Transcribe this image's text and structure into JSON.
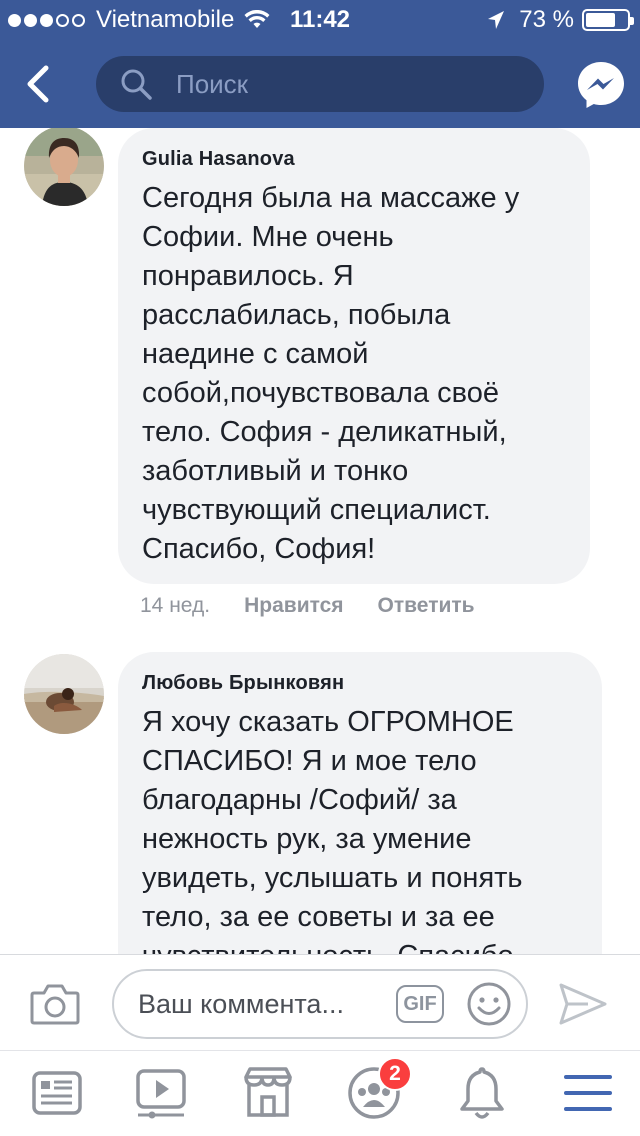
{
  "status_bar": {
    "carrier": "Vietnamobile",
    "time": "11:42",
    "battery_percent": "73 %",
    "battery_level": 0.73,
    "signal_bars_filled": 3,
    "signal_bars_total": 5
  },
  "navbar": {
    "search_placeholder": "Поиск",
    "back_icon": "back-chevron-icon",
    "messenger_icon": "messenger-icon"
  },
  "comments": [
    {
      "author": "Gulia Hasanova",
      "text": "Сегодня была на массаже у\nСофии. Мне очень\nпонравилось. Я\nрасслабилась, побыла\nнаедине с самой\nсобой,почувствовала своё\nтело. София - деликатный,\nзаботливый и тонко\nчувствующий специалист.\nСпасибо, София!",
      "time": "14 нед.",
      "like_label": "Нравится",
      "reply_label": "Ответить"
    },
    {
      "author": "Любовь Брынковян",
      "text": "Я хочу сказать ОГРОМНОЕ\nСПАСИБО! Я и мое тело\nблагодарны /Софий/ за\nнежность рук, за умение\nувидеть, услышать и понять\nтело, за ее советы и за ее\nчувствительность. Спасибо"
    }
  ],
  "composer": {
    "placeholder": "Ваш коммента...",
    "gif_label": "GIF"
  },
  "tabbar": {
    "tabs": [
      "news-feed-icon",
      "video-icon",
      "marketplace-icon",
      "groups-icon",
      "notifications-icon",
      "menu-icon"
    ],
    "groups_badge": "2"
  },
  "colors": {
    "brand_blue": "#3b5998",
    "search_bg": "#293e6a",
    "bubble_bg": "#f2f3f5",
    "active_tab": "#4267b2",
    "badge_red": "#fa3e3e"
  }
}
